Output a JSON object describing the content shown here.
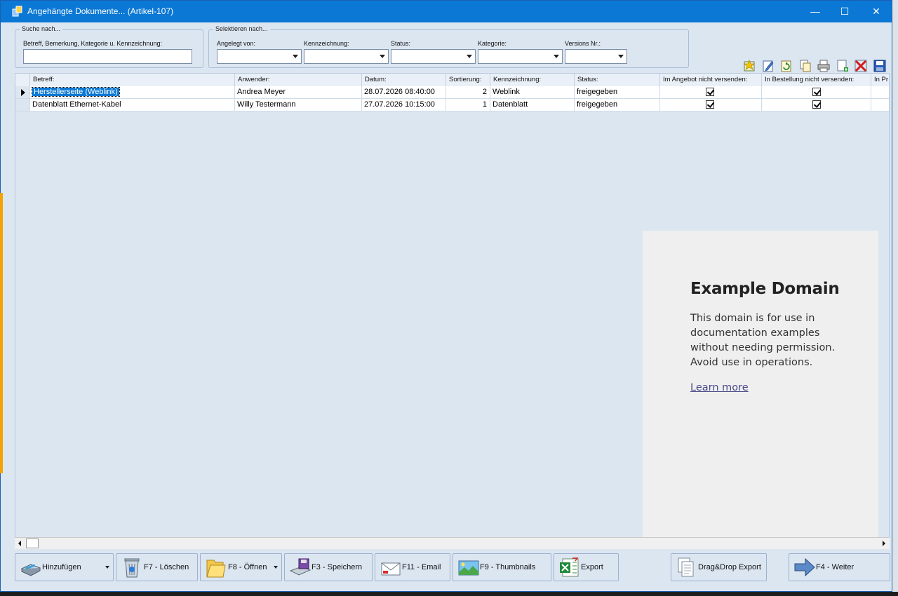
{
  "window": {
    "title": "Angehängte Dokumente... (Artikel-107)",
    "minimize": "—",
    "maximize": "☐",
    "close": "✕"
  },
  "search": {
    "legend": "Suche nach...",
    "label": "Betreff, Bemerkung, Kategorie u. Kennzeichnung:",
    "value": ""
  },
  "filter": {
    "legend": "Selektieren nach...",
    "fields": [
      {
        "label": "Angelegt von:",
        "value": ""
      },
      {
        "label": "Kennzeichnung:",
        "value": ""
      },
      {
        "label": "Status:",
        "value": ""
      },
      {
        "label": "Kategorie:",
        "value": ""
      },
      {
        "label": "Versions Nr.:",
        "value": ""
      }
    ]
  },
  "toolbar": {
    "icons": [
      "new-document-icon",
      "edit-icon",
      "refresh-icon",
      "copy-icon",
      "print-icon",
      "add-file-icon",
      "delete-icon",
      "save-icon"
    ]
  },
  "grid": {
    "columns": [
      "Betreff:",
      "Anwender:",
      "Datum:",
      "Sortierung:",
      "Kennzeichnung:",
      "Status:",
      "Im Angebot nicht versenden:",
      "In Bestellung nicht versenden:",
      "In Pr"
    ],
    "rows": [
      {
        "betreff": "Herstellerseite (Weblink)",
        "anwender": "Andrea Meyer",
        "datum": "28.07.2026 08:40:00",
        "sortierung": "2",
        "kennzeichnung": "Weblink",
        "status": "freigegeben",
        "angebot": true,
        "bestellung": true
      },
      {
        "betreff": "Datenblatt Ethernet-Kabel",
        "anwender": "Willy Testermann",
        "datum": "27.07.2026 10:15:00",
        "sortierung": "1",
        "kennzeichnung": "Datenblatt",
        "status": "freigegeben",
        "angebot": true,
        "bestellung": true
      }
    ]
  },
  "preview": {
    "heading": "Example Domain",
    "body": "This domain is for use in documentation examples without needing permission. Avoid use in operations.",
    "link": "Learn more"
  },
  "buttons": {
    "add": "Hinzufügen",
    "delete": "F7 - Löschen",
    "open": "F8 - Öffnen",
    "save": "F3 - Speichern",
    "email": "F11 - Email",
    "thumbnails": "F9 - Thumbnails",
    "export": "Export",
    "dragdrop": "Drag&Drop Export",
    "next": "F4 - Weiter"
  },
  "colors": {
    "titlebar": "#0a78d4",
    "background": "#dce6f1",
    "selection": "#0a78d4"
  }
}
